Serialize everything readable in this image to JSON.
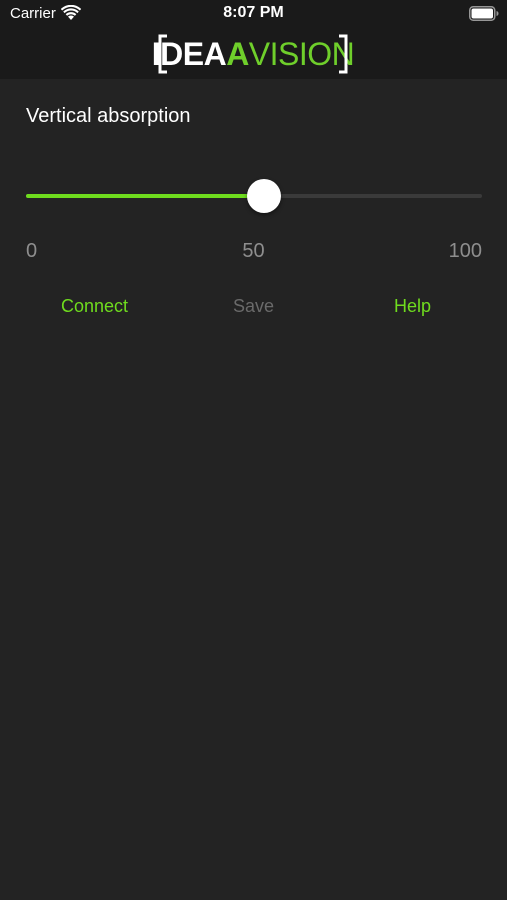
{
  "status_bar": {
    "carrier": "Carrier",
    "time": "8:07 PM",
    "wifi_icon": "wifi-icon",
    "battery_icon": "battery-full-icon"
  },
  "header": {
    "logo_idea": "IDEA",
    "logo_a": "A",
    "logo_vision": "VISION"
  },
  "main": {
    "title": "Vertical absorption",
    "slider": {
      "min": 0,
      "max": 100,
      "value": 50
    },
    "ticks": {
      "min_label": "0",
      "mid_label": "50",
      "max_label": "100"
    },
    "actions": {
      "connect": "Connect",
      "save": "Save",
      "help": "Help"
    }
  },
  "colors": {
    "accent": "#6fdc1e",
    "background": "#232323",
    "header_background": "#1a1a1a",
    "muted_text": "#8e8e8e",
    "disabled_text": "#6a6a6a"
  }
}
